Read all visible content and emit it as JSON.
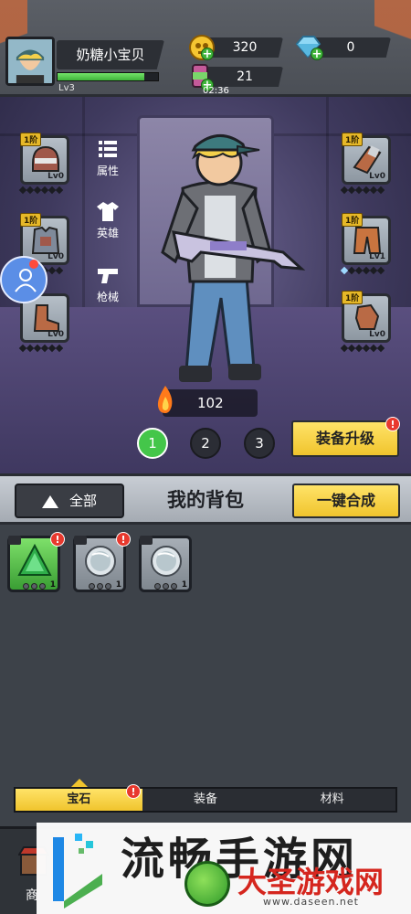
{
  "player": {
    "name": "奶糖小宝贝",
    "level": "Lv3",
    "xp_fraction": 0.86
  },
  "resources": {
    "gold": "320",
    "diamond": "0",
    "energy": "21",
    "timer": "02:36"
  },
  "hero_menu": {
    "attributes": "属性",
    "hero": "英雄",
    "weapon": "枪械"
  },
  "equipment_left": [
    {
      "grade": "1阶",
      "level": "Lv0",
      "icon": "helmet-icon"
    },
    {
      "grade": "1阶",
      "level": "Lv0",
      "icon": "armor-vest-icon"
    },
    {
      "grade": "",
      "level": "Lv0",
      "icon": "boot-icon"
    }
  ],
  "equipment_right": [
    {
      "grade": "1阶",
      "level": "Lv0",
      "icon": "bracer-icon"
    },
    {
      "grade": "1阶",
      "level": "Lv1",
      "icon": "pants-icon"
    },
    {
      "grade": "1阶",
      "level": "Lv0",
      "icon": "glove-icon"
    }
  ],
  "power": "102",
  "pages": [
    "1",
    "2",
    "3"
  ],
  "upgrade_button": "装备升级",
  "bag": {
    "filter_label": "全部",
    "title": "我的背包",
    "merge_button": "一键合成",
    "items": [
      {
        "type": "green-gem",
        "quantity": "1"
      },
      {
        "type": "silver-gem",
        "quantity": "1"
      },
      {
        "type": "silver-gem",
        "quantity": "1"
      }
    ]
  },
  "tabs": [
    "宝石",
    "装备",
    "材料"
  ],
  "bottom": {
    "shop_label": "商"
  },
  "watermark": {
    "big_text": "流畅手游网",
    "brand": "大圣游戏网",
    "url": "www.daseen.net"
  },
  "colors": {
    "accent_yellow": "#f0c42d",
    "active_green": "#44c64a",
    "badge_red": "#e8392e"
  }
}
